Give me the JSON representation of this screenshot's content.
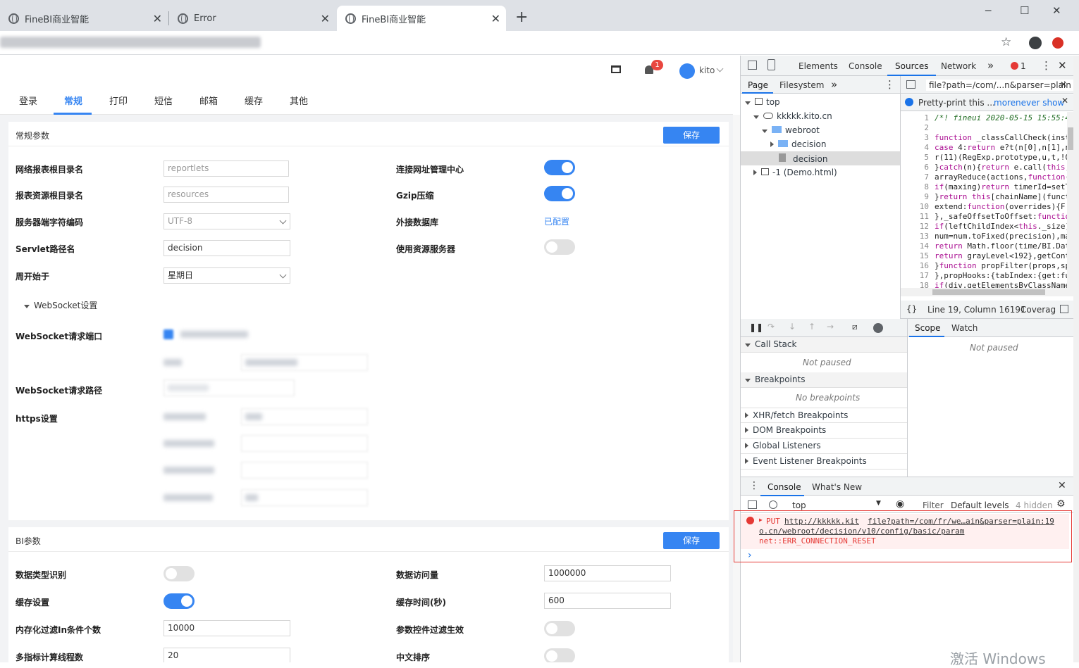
{
  "browser": {
    "tabs": [
      {
        "title": "FineBI商业智能"
      },
      {
        "title": "Error"
      },
      {
        "title": "FineBI商业智能"
      }
    ],
    "close_glyph": "✕",
    "new_tab_glyph": "+",
    "window_min": "─",
    "window_max": "☐",
    "window_close": "✕"
  },
  "app": {
    "header": {
      "notification_count": "1",
      "user": "kito"
    },
    "tabs": [
      "登录",
      "常规",
      "打印",
      "短信",
      "邮箱",
      "缓存",
      "其他"
    ],
    "selected_tab": "常规",
    "general": {
      "title": "常规参数",
      "save": "保存",
      "rows": {
        "report_root_label": "网络报表根目录名",
        "report_root_value": "reportlets",
        "resource_root_label": "报表资源根目录名",
        "resource_root_value": "resources",
        "encoding_label": "服务器端字符编码",
        "encoding_value": "UTF-8",
        "servlet_label": "Servlet路径名",
        "servlet_value": "decision",
        "week_label": "周开始于",
        "week_value": "星期日",
        "connect_label": "连接网址管理中心",
        "gzip_label": "Gzip压缩",
        "extdb_label": "外接数据库",
        "extdb_value": "已配置",
        "resserver_label": "使用资源服务器",
        "websocket_group": "WebSocket设置",
        "ws_port_label": "WebSocket请求端口",
        "ws_path_label": "WebSocket请求路径",
        "https_label": "https设置"
      }
    },
    "bi": {
      "title": "BI参数",
      "save": "保存",
      "rows": {
        "type_detect_label": "数据类型识别",
        "cache_label": "缓存设置",
        "memfilter_label": "内存化过滤In条件个数",
        "memfilter_value": "10000",
        "multi_label": "多指标计算线程数",
        "multi_value": "20",
        "visits_label": "数据访问量",
        "visits_value": "1000000",
        "cache_time_label": "缓存时间(秒)",
        "cache_time_value": "600",
        "param_filter_label": "参数控件过滤生效",
        "cn_sort_label": "中文排序"
      }
    },
    "toggles": {
      "connect": true,
      "gzip": true,
      "resserver": false,
      "type_detect": false,
      "cache": true,
      "param_filter": false,
      "cn_sort": false
    }
  },
  "devtools": {
    "tabs": [
      "Elements",
      "Console",
      "Sources",
      "Network"
    ],
    "selected_tab": "Sources",
    "error_count": "1",
    "nav_tabs": [
      "Page",
      "Filesystem"
    ],
    "file_tab": "file?path=/com/...n&parser=plain",
    "tree": {
      "top": "top",
      "domain": "kkkkk.kito.cn",
      "webroot": "webroot",
      "decision_folder": "decision",
      "decision_file": "decision",
      "demo": "-1 (Demo.html)"
    },
    "pretty_print": {
      "text": "Pretty-print this ...",
      "more": "more",
      "never": "never show"
    },
    "code_lines": [
      "/*! fineui 2020-05-15 15:55:44",
      "",
      "function _classCallCheck(insta",
      "case 4:return e?t(n[0],n[1],n",
      "r(11)(RegExp.prototype,u,t,!0",
      "}catch(n){return e.call(this,",
      "arrayReduce(actions,function(",
      "if(maxing)return timerId=setT",
      "}return this[chainName](functi",
      "extend:function(overrides){F.p",
      "},_safeOffsetToOffset:function",
      "if(leftChildIndex<this._size)",
      "num=num.toFixed(precision),ma",
      "return Math.floor(time/BI.Date",
      "return grayLevel<192},getCont",
      "}function propFilter(props,sp",
      "},propHooks:{tabIndex:{get:fun",
      "if(div.getElementsByClassName",
      ""
    ],
    "status_line": "Line 19, Column 16191",
    "coverage": "Coverag",
    "scope_tabs": [
      "Scope",
      "Watch"
    ],
    "sections": {
      "call_stack": "Call Stack",
      "not_paused": "Not paused",
      "breakpoints": "Breakpoints",
      "no_breakpoints": "No breakpoints",
      "xhr": "XHR/fetch Breakpoints",
      "dom": "DOM Breakpoints",
      "global": "Global Listeners",
      "event": "Event Listener Breakpoints"
    },
    "scope_not_paused": "Not paused",
    "console": {
      "tabs": [
        "Console",
        "What's New"
      ],
      "context": "top",
      "filter": "Filter",
      "levels": "Default levels",
      "hidden": "4 hidden",
      "error": {
        "method": "PUT",
        "url1": "http://kkkkk.kit",
        "source": "file?path=/com/fr/we…ain&parser=plain:19",
        "url2": "o.cn/webroot/decision/v10/config/basic/param",
        "message": "net::ERR_CONNECTION_RESET"
      },
      "prompt": "›"
    }
  },
  "watermark": "激活 Windows"
}
